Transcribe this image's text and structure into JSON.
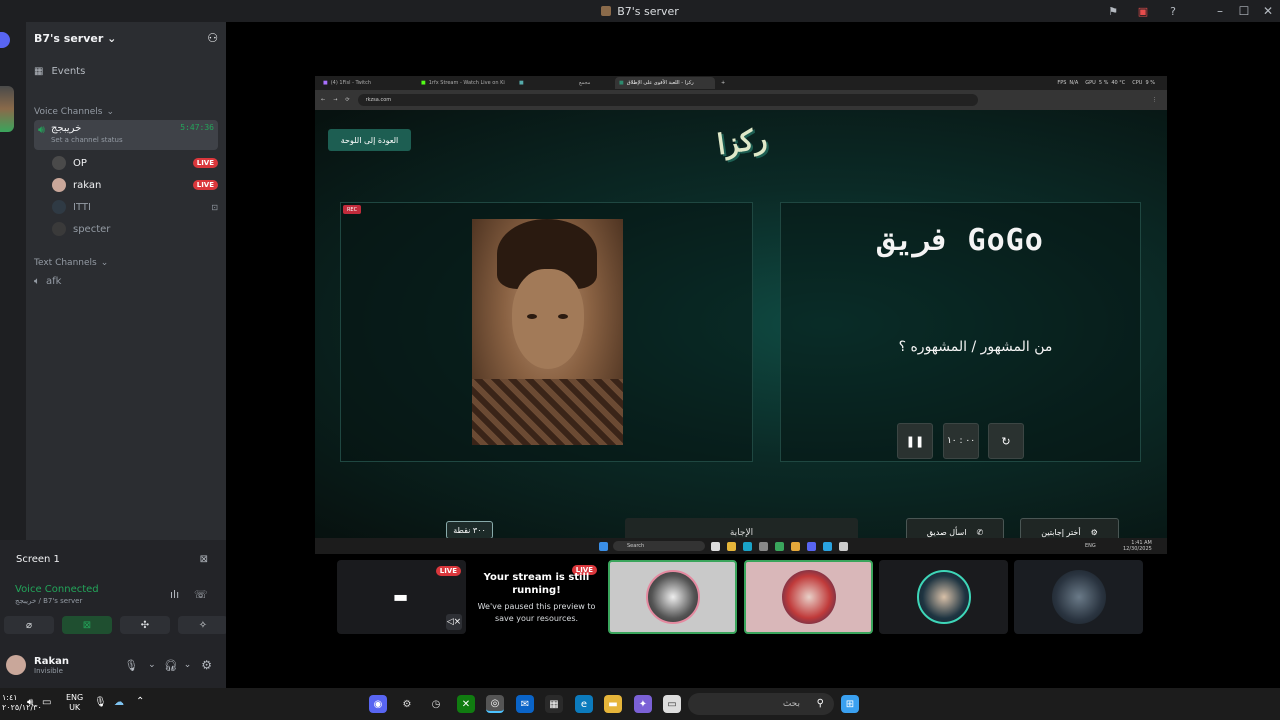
{
  "window": {
    "title": "B7's server"
  },
  "sidebar": {
    "server_name": "B7's server",
    "events_label": "Events",
    "voice_category": "Voice Channels",
    "voice_channel": {
      "name": "خريبجج",
      "timer": "5:47:36",
      "status": "Set a channel status"
    },
    "members": [
      {
        "name": "OP",
        "live": "LIVE"
      },
      {
        "name": "rakan",
        "live": "LIVE"
      },
      {
        "name": "ITTI",
        "live": ""
      },
      {
        "name": "specter",
        "live": ""
      }
    ],
    "text_category": "Text Channels",
    "text_channel": "afk"
  },
  "screen_panel": {
    "label": "Screen 1"
  },
  "voice_panel": {
    "status": "Voice Connected",
    "location": "خريبجج / B7's server"
  },
  "user_panel": {
    "name": "Rakan",
    "status": "Invisible"
  },
  "stream": {
    "browser_tabs": [
      "(4) 1Fisl - Twitch",
      "1rfx Stream - Watch Live on Ki",
      "",
      "مجمع",
      "ركزا - اللعبة الأقوى على الإطلاق"
    ],
    "status_strip": {
      "fps_label": "FPS",
      "fps": "N/A",
      "gpu_label": "GPU",
      "gpu": "5 %",
      "temp": "40 °C",
      "cpu_label": "CPU",
      "cpu": "9 %"
    },
    "url": "rkzsa.com",
    "back_button": "العودة إلى اللوحة",
    "logo": "ركزا",
    "recording_badge": "REC",
    "team_name": "فريق GoGo",
    "question": "من المشهور / المشهوره ؟",
    "timer_display": "٠٠ : ١٠",
    "points": "٣٠٠ نقطة",
    "answer_button": "الإجابة",
    "ask_friend_button": "اسأل صديق",
    "choose_answers_button": "أختر إجابتين",
    "taskbar": {
      "search": "Search",
      "lang": "ENG",
      "time": "1:41 AM",
      "date": "12/30/2025"
    }
  },
  "tiles": [
    {
      "live": "LIVE"
    },
    {
      "live": "LIVE",
      "paused_title": "Your stream is still running!",
      "paused_body": "We've paused this preview to save your resources."
    }
  ],
  "taskbar": {
    "search_placeholder": "بحث",
    "lang_top": "ENG",
    "lang_bottom": "UK",
    "clock_top": "١:٤١",
    "clock_bottom": "٢٠٢٥/١٢/٣٠"
  },
  "colors": {
    "accent_green": "#23a55a",
    "live_red": "#da373c",
    "site_teal": "#1d5e52"
  }
}
